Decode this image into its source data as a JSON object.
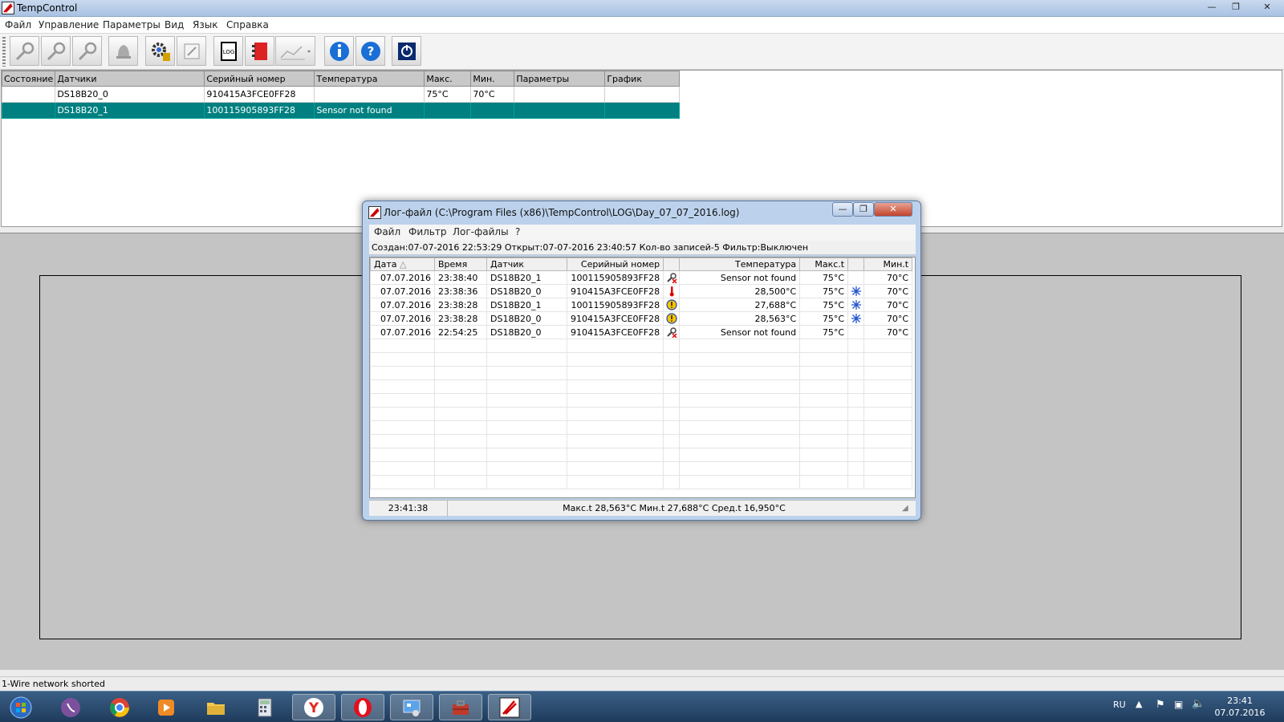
{
  "window": {
    "title": "TempControl"
  },
  "menu": [
    "Файл",
    "Управление",
    "Параметры",
    "Вид",
    "Язык",
    "Справка"
  ],
  "toolbar": {
    "buttons": [
      "connect-icon",
      "disconnect-icon",
      "search-sensor-icon",
      "bell-icon",
      "settings-icon",
      "edit-icon",
      "log-icon",
      "notebook-icon",
      "chart-icon",
      "info-icon",
      "help-icon",
      "power-icon"
    ]
  },
  "sensors": {
    "columns": [
      "Состояние",
      "Датчики",
      "Серийный номер",
      "Температура",
      "Макс.",
      "Мин.",
      "Параметры",
      "График"
    ],
    "rows": [
      {
        "state": "",
        "name": "DS18B20_0",
        "serial": "910415A3FCE0FF28",
        "temp": "",
        "max": "75°C",
        "min": "70°C",
        "params": "",
        "graph": ""
      },
      {
        "state": "",
        "name": "DS18B20_1",
        "serial": "100115905893FF28",
        "temp": "Sensor not found",
        "max": "",
        "min": "",
        "params": "",
        "graph": ""
      }
    ],
    "selected_index": 1,
    "selection_color": "#008080"
  },
  "status": {
    "text": "1-Wire network shorted"
  },
  "log_dialog": {
    "title": "Лог-файл (C:\\Program Files (x86)\\TempControl\\LOG\\Day_07_07_2016.log)",
    "menu": [
      "Файл",
      "Фильтр",
      "Лог-файлы",
      "?"
    ],
    "info": "Создан:07-07-2016 22:53:29 Открыт:07-07-2016 23:40:57 Кол-во записей-5 Фильтр:Выключен",
    "columns": [
      "Дата",
      "Время",
      "Датчик",
      "Серийный номер",
      "",
      "Температура",
      "Макс.t",
      "",
      "Мин.t"
    ],
    "sort_indicator": "△",
    "rows": [
      {
        "date": "07.07.2016",
        "time": "23:38:40",
        "sensor": "DS18B20_1",
        "serial": "100115905893FF28",
        "icon": "sensor-missing-icon",
        "temp": "Sensor not found",
        "max": "75°C",
        "icon2": "",
        "min": "70°C"
      },
      {
        "date": "07.07.2016",
        "time": "23:38:36",
        "sensor": "DS18B20_0",
        "serial": "910415A3FCE0FF28",
        "icon": "thermometer-icon",
        "temp": "28,500°C",
        "max": "75°C",
        "icon2": "snowflake-icon",
        "min": "70°C"
      },
      {
        "date": "07.07.2016",
        "time": "23:38:28",
        "sensor": "DS18B20_1",
        "serial": "100115905893FF28",
        "icon": "warning-icon",
        "temp": "27,688°C",
        "max": "75°C",
        "icon2": "snowflake-icon",
        "min": "70°C"
      },
      {
        "date": "07.07.2016",
        "time": "23:38:28",
        "sensor": "DS18B20_0",
        "serial": "910415A3FCE0FF28",
        "icon": "warning-icon",
        "temp": "28,563°C",
        "max": "75°C",
        "icon2": "snowflake-icon",
        "min": "70°C"
      },
      {
        "date": "07.07.2016",
        "time": "22:54:25",
        "sensor": "DS18B20_0",
        "serial": "910415A3FCE0FF28",
        "icon": "sensor-missing-icon",
        "temp": "Sensor not found",
        "max": "75°C",
        "icon2": "",
        "min": "70°C"
      }
    ],
    "status_time": "23:41:38",
    "status_stats": "Макс.t 28,563°C Мин.t 27,688°C Сред.t 16,950°C"
  },
  "taskbar": {
    "apps": [
      "start-icon",
      "viber-icon",
      "chrome-icon",
      "media-player-icon",
      "folder-icon",
      "calculator-icon",
      "yandex-icon",
      "opera-icon",
      "control-panel-icon",
      "toolbox-icon",
      "tempcontrol-icon"
    ],
    "active_index": 10,
    "lang": "RU",
    "time": "23:41",
    "date": "07.07.2016"
  }
}
